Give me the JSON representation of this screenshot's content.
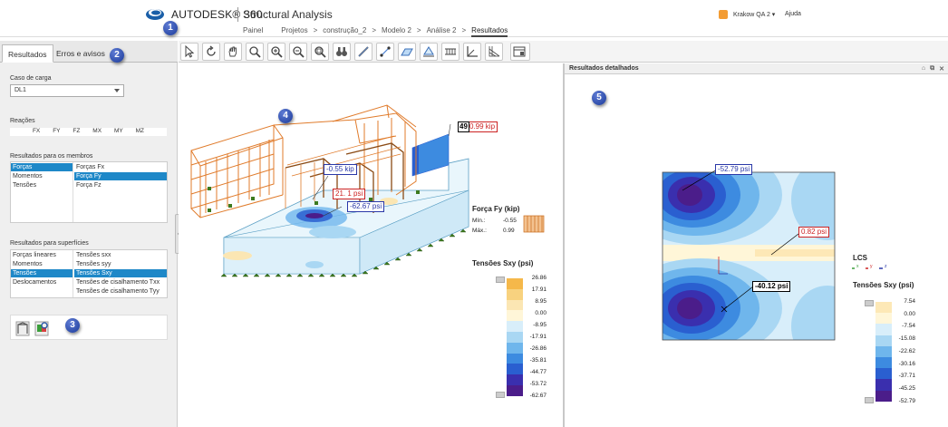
{
  "header": {
    "brand": "AUTODESK® 360",
    "product": "Structural Analysis",
    "breadcrumbs": [
      "Painel",
      "Projetos",
      ">",
      "construção_2",
      ">",
      "Modelo 2",
      ">",
      "Análise 2",
      ">",
      "Resultados"
    ],
    "user": "Krakow QA 2 ▾",
    "help": "Ajuda"
  },
  "markers": [
    "1",
    "2",
    "3",
    "4",
    "5"
  ],
  "panel": {
    "tabs": [
      "Resultados",
      "Erros e avisos"
    ],
    "load_case_label": "Caso de carga",
    "load_case_value": "DL1",
    "reactions_label": "Reações",
    "reactions": [
      "FX",
      "FY",
      "FZ",
      "MX",
      "MY",
      "MZ"
    ],
    "member_results_label": "Resultados para os membros",
    "member_categories": [
      "Forças",
      "Momentos",
      "Tensões"
    ],
    "member_items": [
      "Forças Fx",
      "Força Fy",
      "Força Fz"
    ],
    "surface_results_label": "Resultados para superfícies",
    "surface_categories": [
      "Forças lineares",
      "Momentos",
      "Tensões",
      "Deslocamentos"
    ],
    "surface_items": [
      "Tensões sxx",
      "Tensões syy",
      "Tensões Sxy",
      "Tensões de cisalhamento Txx",
      "Tensões de cisalhamento Tyy"
    ]
  },
  "toolbar": {
    "icons": [
      "select-icon",
      "rotate-icon",
      "pan-icon",
      "zoom-icon",
      "zoom-in-icon",
      "zoom-out-icon",
      "zoom-fit-icon",
      "binoculars-icon",
      "member-icon",
      "node-icon",
      "surface-icon",
      "support-icon",
      "load-icon",
      "axis-icon",
      "grid-icon",
      "settings-icon"
    ]
  },
  "view1": {
    "callouts": [
      "-0.55 kip",
      "0.99 kip",
      "21. 1 psi",
      "-62.67 psi",
      "49"
    ],
    "fy_title": "Força Fy (kip)",
    "fy_min_label": "Mín.:",
    "fy_min": "-0.55",
    "fy_max_label": "Máx.:",
    "fy_max": "0.99",
    "legend_title": "Tensões Sxy (psi)",
    "legend_values": [
      "26.86",
      "17.91",
      "8.95",
      "0.00",
      "-8.95",
      "-17.91",
      "-26.86",
      "-35.81",
      "-44.77",
      "-53.72",
      "-62.67"
    ],
    "legend_colors": [
      "#f5b84a",
      "#f8d27f",
      "#fbe6b3",
      "#fff6d8",
      "#d8eefa",
      "#a9d7f3",
      "#6fb6ec",
      "#3d8be0",
      "#2a5fd0",
      "#3a2fae",
      "#4b1d8a"
    ]
  },
  "view2": {
    "title": "Resultados detalhados",
    "callouts": [
      "-52.79 psi",
      "0.82 psi",
      "-40.12 psi"
    ],
    "lcs_label": "LCS",
    "lcs_axes": [
      "x",
      "y",
      "z"
    ],
    "legend_title": "Tensões Sxy (psi)",
    "legend_values": [
      "7.54",
      "0.00",
      "-7.54",
      "-15.08",
      "-22.62",
      "-30.16",
      "-37.71",
      "-45.25",
      "-52.79"
    ],
    "legend_colors": [
      "#fde8b6",
      "#fff6d8",
      "#d8eefa",
      "#a9d7f3",
      "#6fb6ec",
      "#3d8be0",
      "#2a5fd0",
      "#3a2fae",
      "#4b1d8a"
    ]
  }
}
